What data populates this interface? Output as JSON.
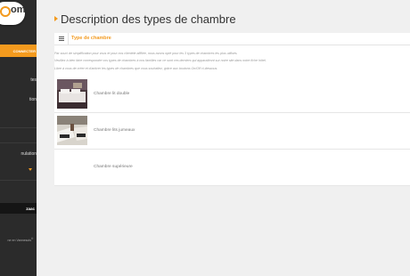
{
  "sidebar": {
    "logo_text": "om",
    "connect_label": "CONNECTER",
    "items": [
      {
        "label": "tes"
      },
      {
        "label": "tion"
      },
      {
        "label": "nulation"
      }
    ],
    "active_label": "zaac",
    "footer": "ne en Vannesois",
    "footer_sup": "®",
    "accent_color": "#f39a1e"
  },
  "page": {
    "title": "Description des types de chambre"
  },
  "tab": {
    "icon": "list-icon",
    "label": "Type de chambre"
  },
  "intro": [
    "Par souci de simplification pour vous et pour nos clientèle affiliée, nous avons opté pour les 3 types de chambres les plus utilisés.",
    "Veuillez à bien faire correspondre vos types de chambres à nos familles car ce sont ces derniers qui apparaîtront sur notre site dans notre fiche hôtel.",
    "Libre à vous de créer et d'activer les types de chambres que vous souhaitez, grâce aux boutons On/Off ci-dessous."
  ],
  "rooms": [
    {
      "label": "Chambre lit double"
    },
    {
      "label": "Chambre lits jumeaux"
    },
    {
      "label": "Chambre supérieure"
    }
  ]
}
